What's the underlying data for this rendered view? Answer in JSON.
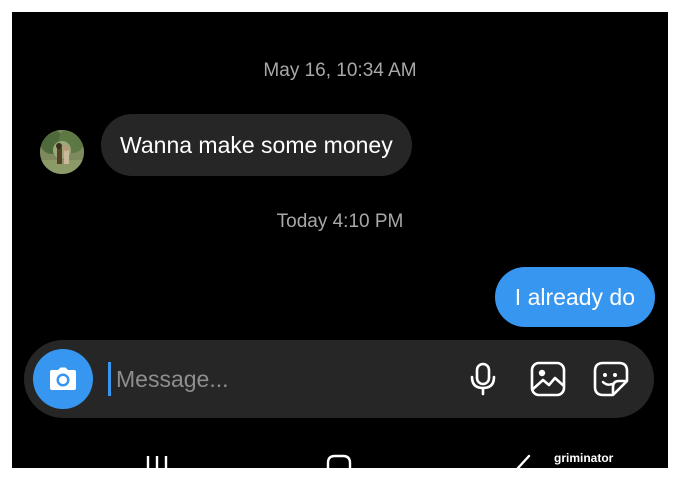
{
  "conversation": {
    "timestamp_1": "May 16, 10:34 AM",
    "incoming_message": "Wanna make some money",
    "timestamp_2": "Today 4:10 PM",
    "outgoing_message": "I already do"
  },
  "composer": {
    "placeholder": "Message...",
    "value": "",
    "icons": [
      "camera-icon",
      "microphone-icon",
      "gallery-icon",
      "sticker-icon"
    ]
  },
  "navigation": {
    "icons": [
      "recent-apps-icon",
      "home-icon",
      "back-icon"
    ]
  },
  "watermark": "griminator",
  "colors": {
    "background": "#000000",
    "incoming_bubble": "#262626",
    "outgoing_bubble": "#3797f0",
    "timestamp_text": "#a8a8a8",
    "placeholder_text": "#8e8e8e"
  }
}
